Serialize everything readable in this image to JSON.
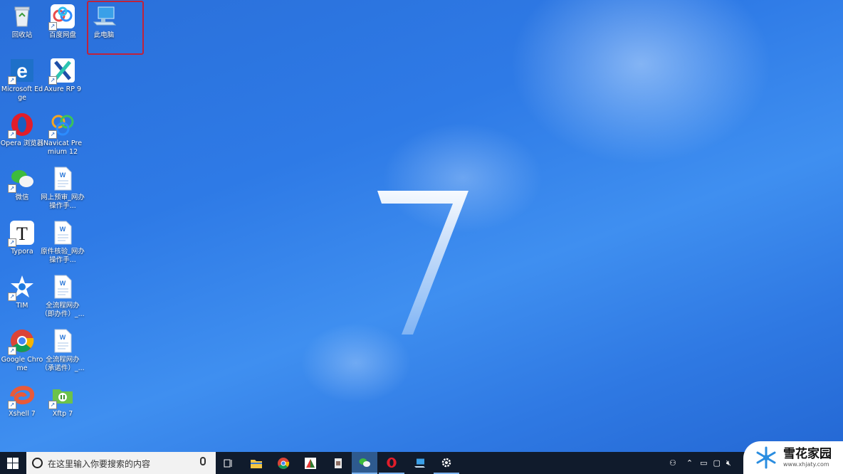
{
  "desktop_icons_col1": [
    {
      "label": "回收站",
      "icon": "recycle-bin-icon"
    },
    {
      "label": "Microsoft Edge",
      "icon": "edge-icon"
    },
    {
      "label": "Opera 浏览器",
      "icon": "opera-icon"
    },
    {
      "label": "微信",
      "icon": "wechat-icon"
    },
    {
      "label": "Typora",
      "icon": "typora-icon"
    },
    {
      "label": "TIM",
      "icon": "tim-icon"
    },
    {
      "label": "Google Chrome",
      "icon": "chrome-icon"
    },
    {
      "label": "Xshell 7",
      "icon": "xshell-icon"
    }
  ],
  "desktop_icons_col2": [
    {
      "label": "百度网盘",
      "icon": "baidu-netdisk-icon"
    },
    {
      "label": "Axure RP 9",
      "icon": "axure-icon"
    },
    {
      "label": "Navicat Premium 12",
      "icon": "navicat-icon"
    },
    {
      "label": "网上预审_网办操作手...",
      "icon": "word-doc-icon"
    },
    {
      "label": "原件核验_网办操作手...",
      "icon": "word-doc-icon"
    },
    {
      "label": "全流程网办（即办件）_...",
      "icon": "word-doc-icon"
    },
    {
      "label": "全流程网办（承诺件）_...",
      "icon": "word-doc-icon"
    },
    {
      "label": "Xftp 7",
      "icon": "xftp-icon"
    }
  ],
  "this_pc": {
    "label": "此电脑",
    "icon": "this-pc-icon"
  },
  "wallpaper_text": "7",
  "taskbar": {
    "search_placeholder": "在这里输入你要搜索的内容"
  },
  "watermark": {
    "title": "雪花家园",
    "url": "www.xhjaty.com"
  }
}
